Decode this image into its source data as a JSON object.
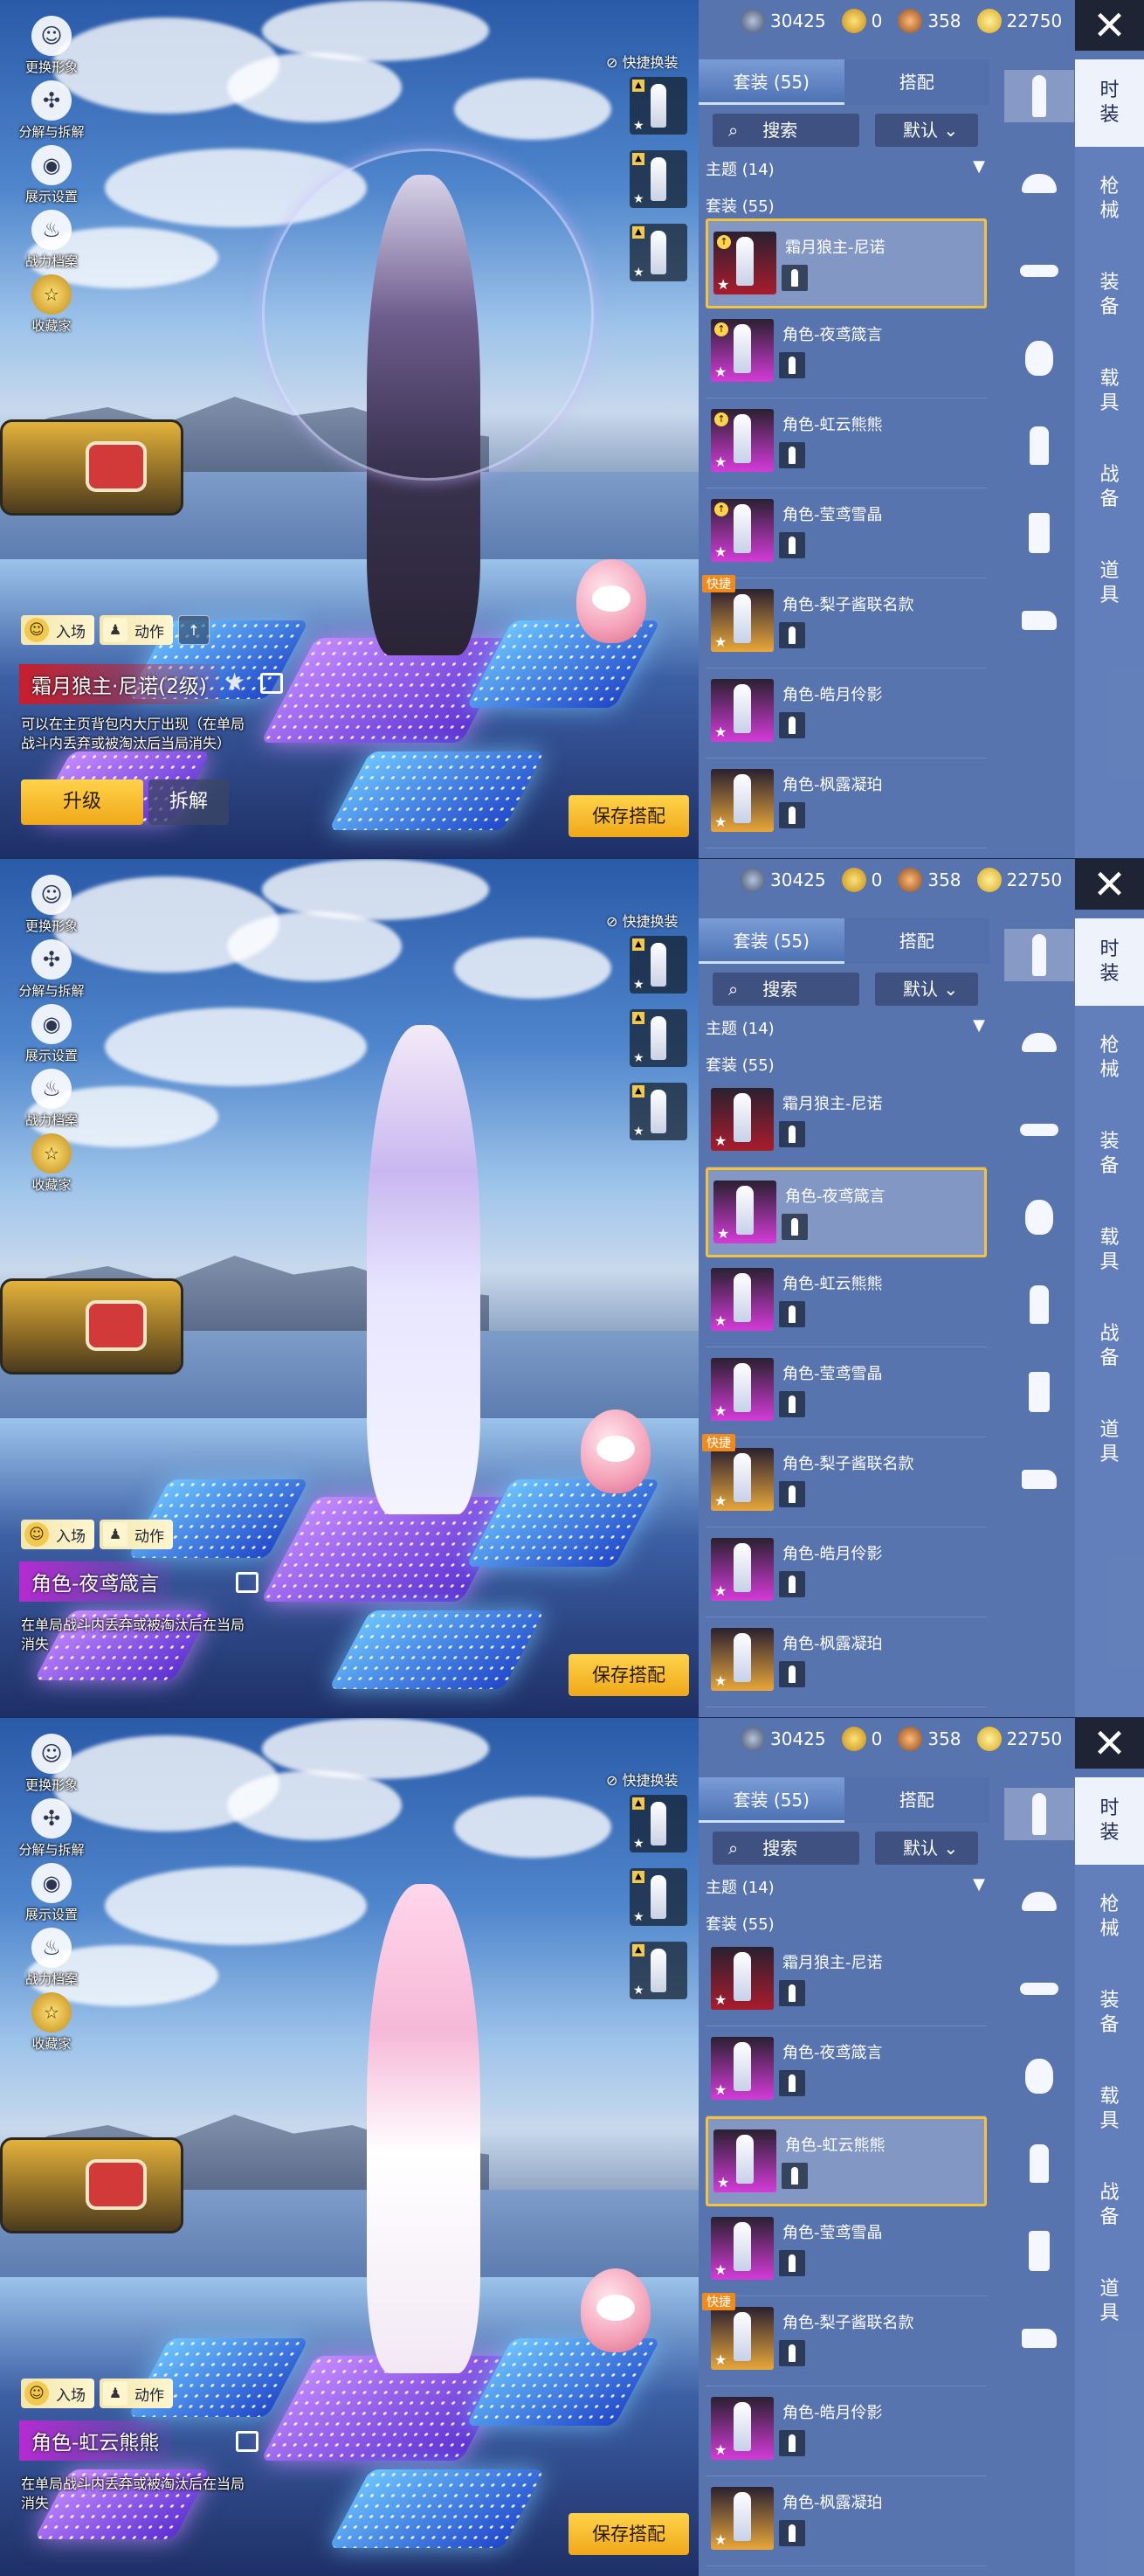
{
  "screens": [
    {
      "currency": [
        "30425",
        "0",
        "358",
        "22750"
      ],
      "left_controls": [
        "更换形象",
        "分解与拆解",
        "展示设置",
        "战力档案",
        "收藏家"
      ],
      "quick_switch": "快捷换装",
      "buttons": {
        "entry": "入场",
        "action": "动作",
        "upgrade": "升级",
        "disassemble": "拆解",
        "save": "保存搭配"
      },
      "item_name": "霜月狼主·尼诺(2级)",
      "description": "可以在主页背包内大厅出现（在单局战斗内丢弃或被淘汰后当局消失）",
      "tabs": [
        "套装 (55)",
        "搭配"
      ],
      "search": "搜索",
      "sort": "默认",
      "theme": "主题 (14)",
      "suit_count": "套装 (55)",
      "items": [
        "霜月狼主-尼诺",
        "角色-夜鸢箴言",
        "角色-虹云熊熊",
        "角色-莹鸢雪晶",
        "角色-梨子酱联名款",
        "角色-皓月伶影",
        "角色-枫露凝珀"
      ],
      "fast_tag": "快捷",
      "sides": [
        [
          "时",
          "装"
        ],
        [
          "枪",
          "械"
        ],
        [
          "装",
          "备"
        ],
        [
          "载",
          "具"
        ],
        [
          "战",
          "备"
        ],
        [
          "道",
          "具"
        ]
      ]
    },
    {
      "currency": [
        "30425",
        "0",
        "358",
        "22750"
      ],
      "left_controls": [
        "更换形象",
        "分解与拆解",
        "展示设置",
        "战力档案",
        "收藏家"
      ],
      "quick_switch": "快捷换装",
      "buttons": {
        "entry": "入场",
        "action": "动作",
        "save": "保存搭配"
      },
      "item_name": "角色-夜鸢箴言",
      "description": "在单局战斗内丢弃或被淘汰后在当局消失",
      "tabs": [
        "套装 (55)",
        "搭配"
      ],
      "search": "搜索",
      "sort": "默认",
      "theme": "主题 (14)",
      "suit_count": "套装 (55)",
      "items": [
        "霜月狼主-尼诺",
        "角色-夜鸢箴言",
        "角色-虹云熊熊",
        "角色-莹鸢雪晶",
        "角色-梨子酱联名款",
        "角色-皓月伶影",
        "角色-枫露凝珀"
      ],
      "fast_tag": "快捷",
      "sides": [
        [
          "时",
          "装"
        ],
        [
          "枪",
          "械"
        ],
        [
          "装",
          "备"
        ],
        [
          "载",
          "具"
        ],
        [
          "战",
          "备"
        ],
        [
          "道",
          "具"
        ]
      ]
    },
    {
      "currency": [
        "30425",
        "0",
        "358",
        "22750"
      ],
      "left_controls": [
        "更换形象",
        "分解与拆解",
        "展示设置",
        "战力档案",
        "收藏家"
      ],
      "quick_switch": "快捷换装",
      "buttons": {
        "entry": "入场",
        "action": "动作",
        "save": "保存搭配"
      },
      "item_name": "角色-虹云熊熊",
      "description": "在单局战斗内丢弃或被淘汰后在当局消失",
      "tabs": [
        "套装 (55)",
        "搭配"
      ],
      "search": "搜索",
      "sort": "默认",
      "theme": "主题 (14)",
      "suit_count": "套装 (55)",
      "items": [
        "霜月狼主-尼诺",
        "角色-夜鸢箴言",
        "角色-虹云熊熊",
        "角色-莹鸢雪晶",
        "角色-梨子酱联名款",
        "角色-皓月伶影",
        "角色-枫露凝珀"
      ],
      "fast_tag": "快捷",
      "sides": [
        [
          "时",
          "装"
        ],
        [
          "枪",
          "械"
        ],
        [
          "装",
          "备"
        ],
        [
          "载",
          "具"
        ],
        [
          "战",
          "备"
        ],
        [
          "道",
          "具"
        ]
      ]
    }
  ],
  "colors": {
    "accent": "#f5c33a",
    "panel": "#5c7ab6",
    "red_rarity": "#c71e2c",
    "pink_rarity": "#b52bd1"
  }
}
